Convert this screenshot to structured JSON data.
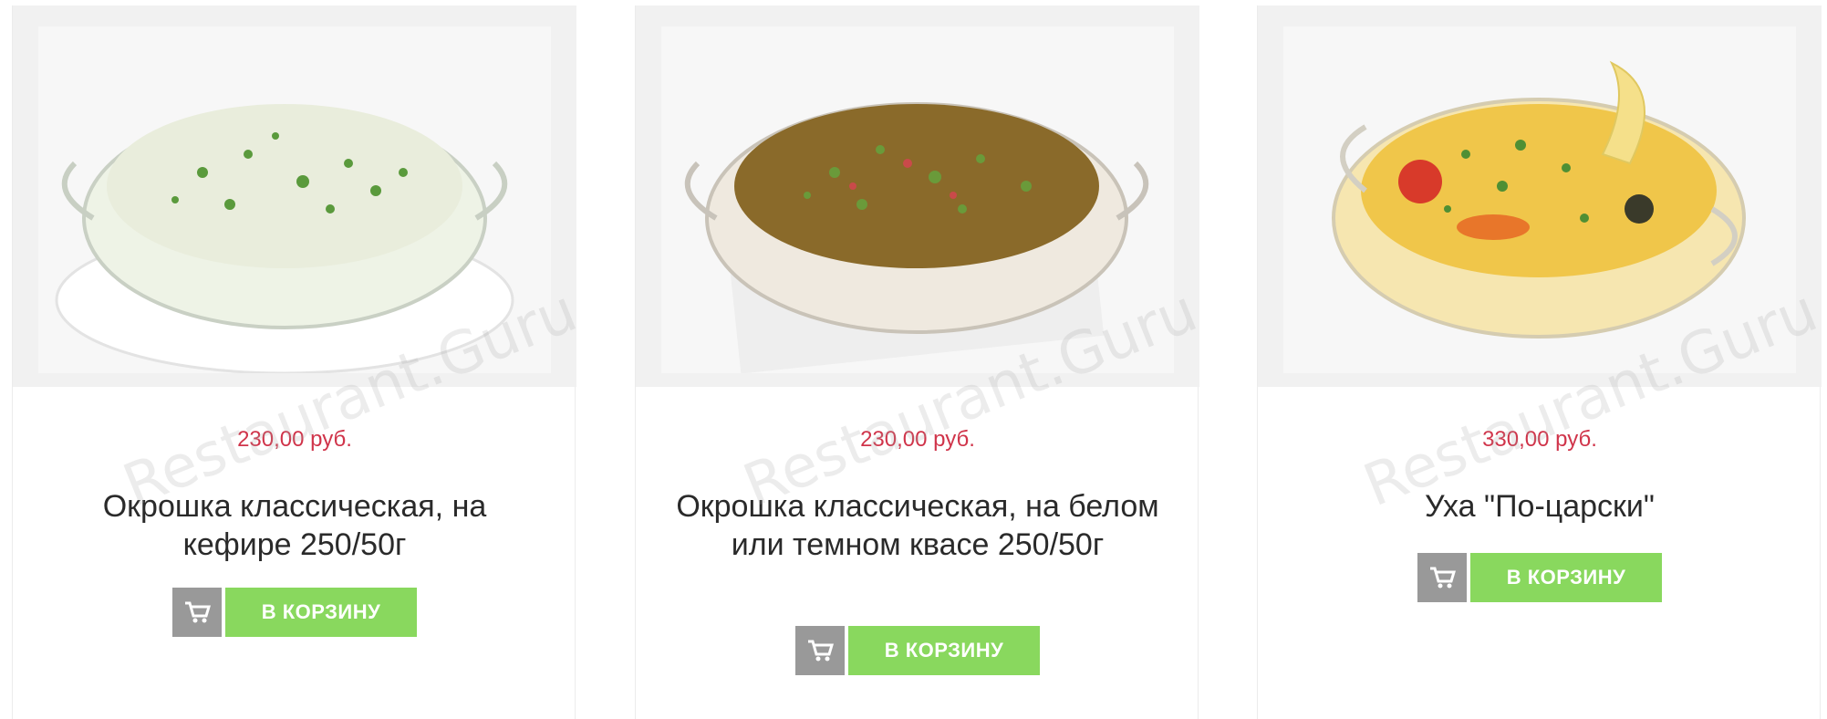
{
  "products": [
    {
      "price": "230,00 руб.",
      "title": "Окрошка классическая, на кефире 250/50г",
      "cart_label": "В КОРЗИНУ",
      "image_icon": "okroshka-kefir-image",
      "soup_color": "#e9eddc"
    },
    {
      "price": "230,00 руб.",
      "title": "Окрошка классическая, на белом или темном квасе 250/50г",
      "cart_label": "В КОРЗИНУ",
      "image_icon": "okroshka-kvass-image",
      "soup_color": "#8a6a2a"
    },
    {
      "price": "330,00 руб.",
      "title": "Уха \"По-царски\"",
      "cart_label": "В КОРЗИНУ",
      "image_icon": "ukha-image",
      "soup_color": "#f0c64a"
    }
  ],
  "watermark": "Restaurant.Guru",
  "colors": {
    "price": "#d0344a",
    "button_green": "#89d85e",
    "icon_gray": "#999999"
  }
}
